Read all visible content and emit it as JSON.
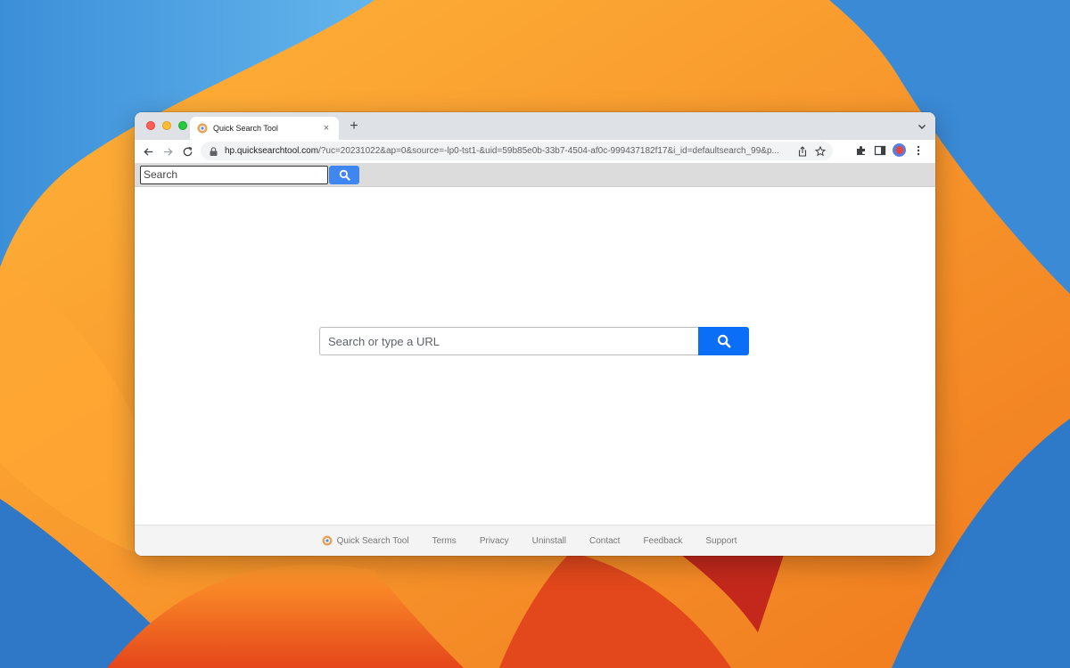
{
  "tab": {
    "title": "Quick Search Tool",
    "close": "×",
    "new_tab": "+"
  },
  "omnibox": {
    "host": "hp.quicksearchtool.com",
    "path": "/?uc=20231022&ap=0&source=-lp0-tst1-&uid=59b85e0b-33b7-4504-af0c-999437182f17&i_id=defaultsearch_99&p..."
  },
  "extension_bar": {
    "search_placeholder": "Search"
  },
  "main": {
    "search_placeholder": "Search or type a URL"
  },
  "footer": {
    "brand": "Quick Search Tool",
    "links": [
      "Terms",
      "Privacy",
      "Uninstall",
      "Contact",
      "Feedback",
      "Support"
    ]
  },
  "icons": {
    "back": "arrow-left-icon",
    "forward": "arrow-right-icon",
    "reload": "reload-icon",
    "lock": "lock-icon",
    "share": "share-icon",
    "bookmark": "star-icon",
    "extensions": "puzzle-icon",
    "side_panel": "side-panel-icon",
    "menu": "kebab-menu-icon",
    "search": "magnifier-icon"
  },
  "colors": {
    "accent_blue": "#0b6ef6",
    "ext_button_blue": "#3f86f0"
  }
}
